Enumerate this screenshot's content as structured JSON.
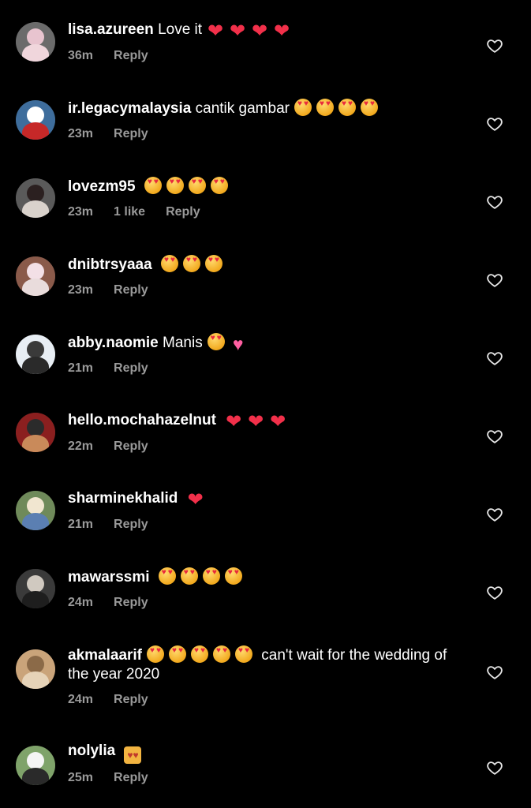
{
  "comments": [
    {
      "username": "lisa.azureen",
      "text": "Love it",
      "emojis": [
        "red-heart",
        "red-heart",
        "red-heart",
        "red-heart"
      ],
      "time": "36m",
      "likes": "",
      "reply": "Reply",
      "avatar_colors": [
        "#6b6b6b",
        "#e8c4cf",
        "#f0d6dc"
      ]
    },
    {
      "username": "ir.legacymalaysia",
      "text": "cantik gambar",
      "emojis": [
        "heart-eyes",
        "heart-eyes",
        "heart-eyes",
        "heart-eyes"
      ],
      "time": "23m",
      "likes": "",
      "reply": "Reply",
      "avatar_colors": [
        "#3e6d9c",
        "#ffffff",
        "#c62828"
      ]
    },
    {
      "username": "lovezm95",
      "text": "",
      "emojis": [
        "heart-eyes",
        "heart-eyes",
        "heart-eyes",
        "heart-eyes"
      ],
      "time": "23m",
      "likes": "1 like",
      "reply": "Reply",
      "avatar_colors": [
        "#5a5a5a",
        "#2b2020",
        "#d9d2cc"
      ]
    },
    {
      "username": "dnibtrsyaaa",
      "text": "",
      "emojis": [
        "heart-eyes",
        "heart-eyes",
        "heart-eyes"
      ],
      "time": "23m",
      "likes": "",
      "reply": "Reply",
      "avatar_colors": [
        "#8a5a4a",
        "#f3e0e6",
        "#e9dcdc"
      ]
    },
    {
      "username": "abby.naomie",
      "text": "Manis",
      "emojis": [
        "heart-eyes",
        "sparkle-heart"
      ],
      "time": "21m",
      "likes": "",
      "reply": "Reply",
      "avatar_colors": [
        "#e8eef4",
        "#3a3a3a",
        "#2a2a2a"
      ]
    },
    {
      "username": "hello.mochahazelnut",
      "text": "",
      "emojis": [
        "red-heart",
        "red-heart",
        "red-heart"
      ],
      "time": "22m",
      "likes": "",
      "reply": "Reply",
      "avatar_colors": [
        "#8b1f1f",
        "#2b2b2b",
        "#c98a5a"
      ]
    },
    {
      "username": "sharminekhalid",
      "text": "",
      "emojis": [
        "red-heart"
      ],
      "time": "21m",
      "likes": "",
      "reply": "Reply",
      "avatar_colors": [
        "#6f8a5a",
        "#f1e6d0",
        "#5b7fb2"
      ]
    },
    {
      "username": "mawarssmi",
      "text": "",
      "emojis": [
        "heart-eyes",
        "heart-eyes",
        "heart-eyes",
        "heart-eyes"
      ],
      "time": "24m",
      "likes": "",
      "reply": "Reply",
      "avatar_colors": [
        "#3a3a3a",
        "#d0c9c0",
        "#1e1e1e"
      ]
    },
    {
      "username": "akmalaarif",
      "text": "can't wait for the wedding of the year 2020",
      "emojis": [
        "heart-eyes",
        "heart-eyes",
        "heart-eyes",
        "heart-eyes",
        "heart-eyes"
      ],
      "emojis_before_text": true,
      "time": "24m",
      "likes": "",
      "reply": "Reply",
      "avatar_colors": [
        "#caa47a",
        "#8b6a48",
        "#e6d3b8"
      ]
    },
    {
      "username": "nolylia",
      "text": "",
      "emojis": [
        "kiss-couple"
      ],
      "time": "25m",
      "likes": "",
      "reply": "Reply",
      "avatar_colors": [
        "#7fa36a",
        "#f5f5f5",
        "#2a2a2a"
      ]
    }
  ],
  "icons": {
    "like": "heart-outline-icon",
    "red_heart": "red-heart-emoji",
    "heart_eyes": "heart-eyes-emoji"
  }
}
